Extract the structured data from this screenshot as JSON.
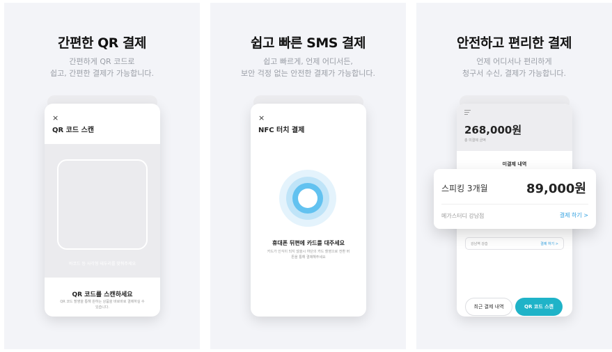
{
  "panels": [
    {
      "title": "간편한 QR 결제",
      "subtitle": [
        "간편하게 QR 코드로",
        "쉽고, 간편한 결제가 가능합니다."
      ],
      "phone": {
        "close": "×",
        "header": "QR 코드 스캔",
        "scan_hint": "바코드 등 사각형 테두리를 맞춰주세요",
        "sheet_title": "QR 코드를 스캔하세요",
        "sheet_desc": "QR 코드 촬영을 통해 원하는 상품을 바로바로 결제하실 수 있습니다."
      }
    },
    {
      "title": "쉽고 빠른 SMS 결제",
      "subtitle": [
        "쉽고 빠르게, 언제 어디서든,",
        "보안 걱정 없는 안전한 결제가 가능합니다."
      ],
      "phone": {
        "close": "×",
        "header": "NFC 터치 결제",
        "nfc_title": "휴대폰 뒤편에 카드를 대주세요",
        "nfc_desc": "카드가 인식이 되지 않을시 하단의 카드 촬영으로 전환 버튼을 통해 결제해주세요"
      }
    },
    {
      "title": "안전하고 편리한 결제",
      "subtitle": [
        "언제 어디서나 편리하게",
        "청구서 수신, 결제가 가능합니다."
      ],
      "phone": {
        "amount": "268,000원",
        "amount_label": "총 미결제 금액",
        "unpaid": "미결제 내역",
        "mini_name": "강남역 강습",
        "mini_pay": "결제 하기 >",
        "btn_recent": "최근 결제 내역",
        "btn_qr": "QR 코드 스캔"
      },
      "card": {
        "name": "스피킹 3개월",
        "price": "89,000원",
        "place": "메가스터디 강남점",
        "pay": "결제 하기 >"
      }
    }
  ]
}
